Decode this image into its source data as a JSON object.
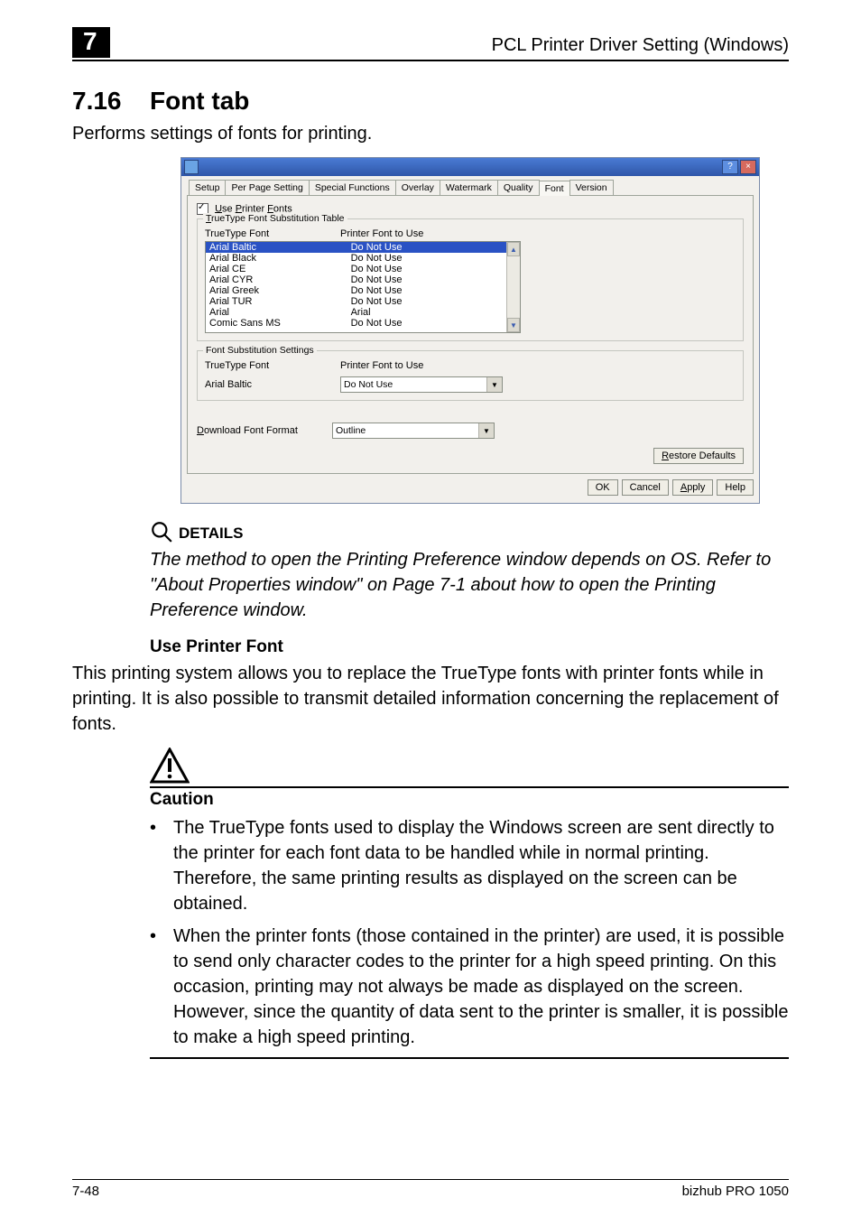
{
  "header": {
    "chapter": "7",
    "title_right": "PCL Printer Driver Setting (Windows)"
  },
  "section": {
    "number": "7.16",
    "title": "Font tab",
    "intro": "Performs settings of fonts for printing."
  },
  "dialog": {
    "tabs": [
      "Setup",
      "Per Page Setting",
      "Special Functions",
      "Overlay",
      "Watermark",
      "Quality",
      "Font",
      "Version"
    ],
    "active_tab": "Font",
    "use_printer_fonts_label": "Use Printer Fonts",
    "group1_legend": "TrueType Font Substitution Table",
    "col1_header": "TrueType Font",
    "col2_header": "Printer Font to Use",
    "list_rows": [
      {
        "tt": "Arial Baltic",
        "pf": "Do Not Use",
        "selected": true
      },
      {
        "tt": "Arial Black",
        "pf": "Do Not Use"
      },
      {
        "tt": "Arial CE",
        "pf": "Do Not Use"
      },
      {
        "tt": "Arial CYR",
        "pf": "Do Not Use"
      },
      {
        "tt": "Arial Greek",
        "pf": "Do Not Use"
      },
      {
        "tt": "Arial TUR",
        "pf": "Do Not Use"
      },
      {
        "tt": "Arial",
        "pf": "Arial"
      },
      {
        "tt": "Comic Sans MS",
        "pf": "Do Not Use"
      }
    ],
    "group2_legend": "Font Substitution Settings",
    "fs_tt_label": "TrueType Font",
    "fs_pf_label": "Printer Font to Use",
    "fs_tt_value": "Arial Baltic",
    "fs_pf_value": "Do Not Use",
    "dl_label": "Download Font Format",
    "dl_value": "Outline",
    "restore_label": "Restore Defaults",
    "ok": "OK",
    "cancel": "Cancel",
    "apply": "Apply",
    "help": "Help"
  },
  "details": {
    "label": "DETAILS",
    "body": "The method to open the Printing Preference window depends on OS. Refer to \"About Properties window\" on Page 7-1 about how to open the Printing Preference window."
  },
  "sub": {
    "heading": "Use Printer Font",
    "para": "This printing system allows you to replace the TrueType fonts with printer fonts while in printing. It is also possible to transmit detailed information concerning the replacement of fonts."
  },
  "caution": {
    "label": "Caution",
    "bullets": [
      "The TrueType fonts used to display the Windows screen are sent directly to the printer for each font data to be handled while in normal printing. Therefore, the same printing results as displayed on the screen can be obtained.",
      "When the printer fonts (those contained in the printer) are used, it is possible to send only character codes to the printer for a high speed printing. On this occasion, printing may not always be made as displayed on the screen. However, since the quantity of data sent to the printer is smaller, it is possible to make a high speed printing."
    ]
  },
  "footer": {
    "left": "7-48",
    "right": "bizhub PRO 1050"
  }
}
